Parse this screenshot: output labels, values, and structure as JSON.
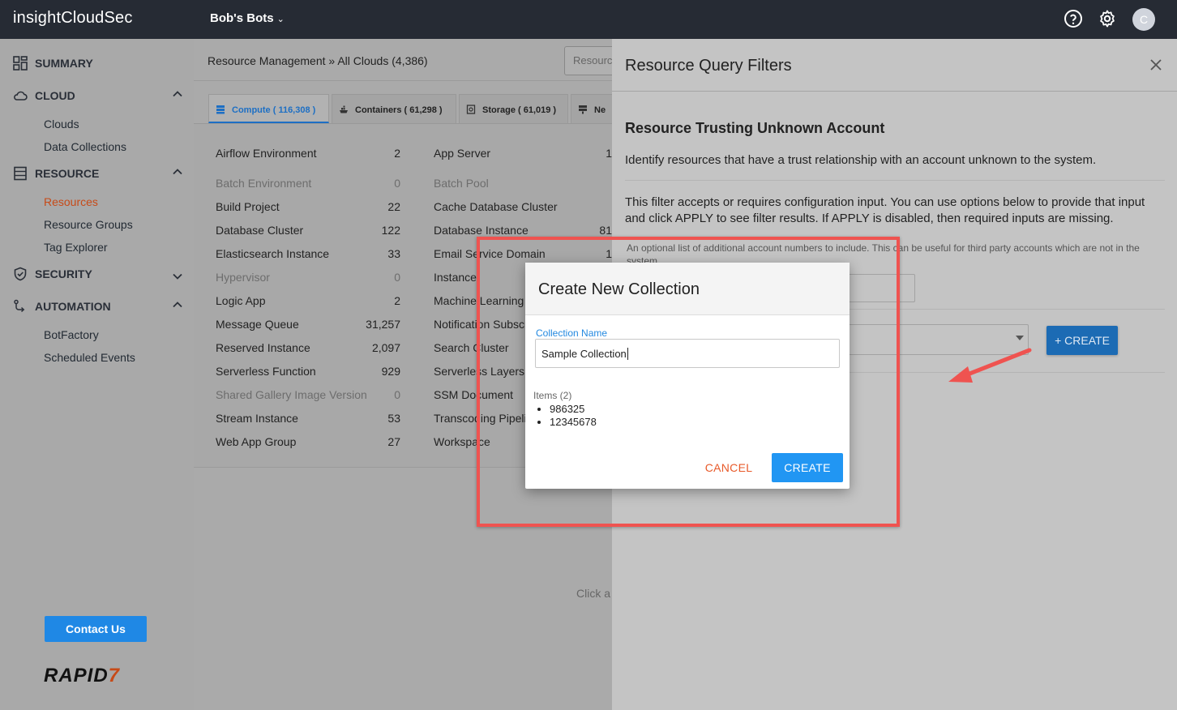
{
  "header": {
    "brand": "insightCloudSec",
    "org_name": "Bob's Bots",
    "avatar_letter": "C",
    "icons": [
      "help-icon",
      "gear-icon"
    ]
  },
  "sidebar": {
    "sections": [
      {
        "label": "SUMMARY",
        "icon": "dashboard-icon"
      },
      {
        "label": "CLOUD",
        "icon": "cloud-icon",
        "items": [
          "Clouds",
          "Data Collections"
        ]
      },
      {
        "label": "RESOURCE",
        "icon": "resource-icon",
        "items": [
          "Resources",
          "Resource Groups",
          "Tag Explorer"
        ],
        "active_item": "Resources"
      },
      {
        "label": "SECURITY",
        "icon": "shield-icon"
      },
      {
        "label": "AUTOMATION",
        "icon": "automation-icon",
        "items": [
          "BotFactory",
          "Scheduled Events"
        ]
      }
    ],
    "contact_label": "Contact Us",
    "logo_text": "RAPID",
    "logo_seven": "7"
  },
  "main": {
    "breadcrumb": "Resource Management » All Clouds (4,386)",
    "search_placeholder": "Resource",
    "tabs": [
      {
        "label": "Compute ( 116,308 )",
        "icon": "compute-icon"
      },
      {
        "label": "Containers ( 61,298 )",
        "icon": "containers-icon"
      },
      {
        "label": "Storage ( 61,019 )",
        "icon": "storage-icon"
      },
      {
        "label": "Ne",
        "icon": "network-icon"
      }
    ],
    "col1": [
      {
        "name": "Airflow Environment",
        "count": "2",
        "dim": false
      },
      {
        "name": "Batch Environment",
        "count": "0",
        "dim": true
      },
      {
        "name": "Build Project",
        "count": "22",
        "dim": false
      },
      {
        "name": "Database Cluster",
        "count": "122",
        "dim": false
      },
      {
        "name": "Elasticsearch Instance",
        "count": "33",
        "dim": false
      },
      {
        "name": "Hypervisor",
        "count": "0",
        "dim": true
      },
      {
        "name": "Logic App",
        "count": "2",
        "dim": false
      },
      {
        "name": "Message Queue",
        "count": "31,257",
        "dim": false
      },
      {
        "name": "Reserved Instance",
        "count": "2,097",
        "dim": false
      },
      {
        "name": "Serverless Function",
        "count": "929",
        "dim": false
      },
      {
        "name": "Shared Gallery Image Version",
        "count": "0",
        "dim": true
      },
      {
        "name": "Stream Instance",
        "count": "53",
        "dim": false
      },
      {
        "name": "Web App Group",
        "count": "27",
        "dim": false
      }
    ],
    "col2": [
      {
        "name": "App Server",
        "count": "1",
        "dim": false
      },
      {
        "name": "Batch Pool",
        "count": "",
        "dim": true
      },
      {
        "name": "Cache Database Cluster",
        "count": "",
        "dim": false
      },
      {
        "name": "Database Instance",
        "count": "81",
        "dim": false
      },
      {
        "name": "Email Service Domain",
        "count": "1",
        "dim": false
      },
      {
        "name": "Instance",
        "count": "",
        "dim": false
      },
      {
        "name": "Machine Learning",
        "count": "",
        "dim": false
      },
      {
        "name": "Notification Subscr",
        "count": "",
        "dim": false
      },
      {
        "name": "Search Cluster",
        "count": "",
        "dim": false
      },
      {
        "name": "Serverless Layers",
        "count": "",
        "dim": false
      },
      {
        "name": "SSM Document",
        "count": "",
        "dim": false
      },
      {
        "name": "Transcoding Pipeli",
        "count": "",
        "dim": false
      },
      {
        "name": "Workspace",
        "count": "",
        "dim": false
      }
    ],
    "click_hint": "Click a"
  },
  "drawer": {
    "title": "Resource Query Filters",
    "filter_title": "Resource Trusting Unknown Account",
    "filter_desc": "Identify resources that have a trust relationship with an account unknown to the system.",
    "filter_note": "This filter accepts or requires configuration input. You can use options below to provide that input and click APPLY to see filter results. If APPLY is disabled, then required inputs are missing.",
    "filter_hint": "An optional list of additional account numbers to include. This can be useful for third party accounts which are not in the system.",
    "create_label": "+ CREATE"
  },
  "modal": {
    "title": "Create New Collection",
    "field_label": "Collection Name",
    "field_value": "Sample Collection",
    "items_label": "Items (2)",
    "items": [
      "986325",
      "12345678"
    ],
    "cancel_label": "CANCEL",
    "create_label": "CREATE"
  },
  "colors": {
    "topbar": "#262b34",
    "accent_blue": "#2196f3",
    "active_orange": "#c74a18",
    "annotation_red": "#ef5350"
  }
}
